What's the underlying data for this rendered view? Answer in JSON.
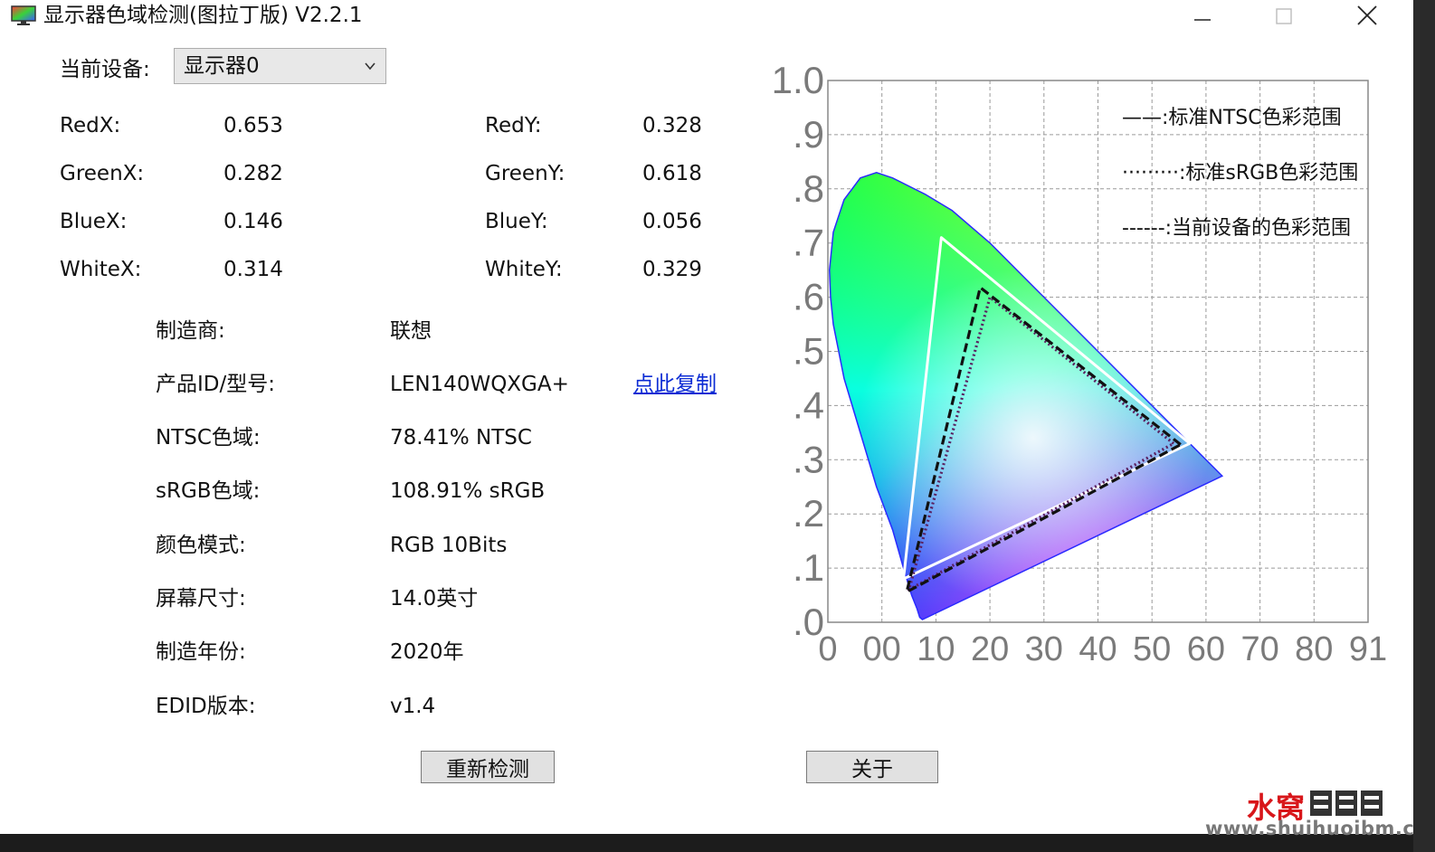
{
  "window": {
    "title": "显示器色域检测(图拉丁版) V2.2.1",
    "app_icon": "monitor-icon",
    "controls": [
      "minimize-icon",
      "maximize-icon",
      "close-icon"
    ]
  },
  "device": {
    "label": "当前设备:",
    "selected": "显示器0"
  },
  "coords": [
    {
      "xlabel": "RedX:",
      "xval": "0.653",
      "ylabel": "RedY:",
      "yval": "0.328"
    },
    {
      "xlabel": "GreenX:",
      "xval": "0.282",
      "ylabel": "GreenY:",
      "yval": "0.618"
    },
    {
      "xlabel": "BlueX:",
      "xval": "0.146",
      "ylabel": "BlueY:",
      "yval": "0.056"
    },
    {
      "xlabel": "WhiteX:",
      "xval": "0.314",
      "ylabel": "WhiteY:",
      "yval": "0.329"
    }
  ],
  "info": [
    {
      "label": "制造商:",
      "value": "联想"
    },
    {
      "label": "产品ID/型号:",
      "value": "LEN140WQXGA+"
    },
    {
      "label": "NTSC色域:",
      "value": "78.41% NTSC"
    },
    {
      "label": "sRGB色域:",
      "value": "108.91% sRGB"
    },
    {
      "label": "颜色模式:",
      "value": "RGB 10Bits"
    },
    {
      "label": "屏幕尺寸:",
      "value": "14.0英寸"
    },
    {
      "label": "制造年份:",
      "value": "2020年"
    },
    {
      "label": "EDID版本:",
      "value": "v1.4"
    }
  ],
  "copy_link": "点此复制",
  "buttons": {
    "redetect": "重新检测",
    "about": "关于"
  },
  "legend": [
    {
      "text": "——:标准NTSC色彩范围"
    },
    {
      "text": "·········:标准sRGB色彩范围"
    },
    {
      "text": "------:当前设备的色彩范围"
    }
  ],
  "watermark": {
    "brand": "水窝",
    "url": "www.shuihuoibm.com"
  },
  "chart_data": {
    "type": "scatter",
    "title": "",
    "xlabel": "",
    "ylabel": "",
    "y_ticks": [
      ".0",
      ".1",
      ".2",
      ".3",
      ".4",
      ".5",
      ".6",
      ".7",
      ".8",
      ".9",
      "1.0"
    ],
    "x_ticks": [
      "0",
      "00",
      "10",
      "20",
      "30",
      "40",
      "50",
      "60",
      "70",
      "80",
      "91"
    ],
    "xlim": [
      0,
      1
    ],
    "ylim": [
      0,
      1
    ],
    "grid": true,
    "series": [
      {
        "name": "标准NTSC色彩范围",
        "style": "solid",
        "color": "#ffffff",
        "points": [
          [
            0.67,
            0.33
          ],
          [
            0.21,
            0.71
          ],
          [
            0.14,
            0.08
          ]
        ]
      },
      {
        "name": "标准sRGB色彩范围",
        "style": "dotted",
        "color": "#5a2060",
        "points": [
          [
            0.64,
            0.33
          ],
          [
            0.3,
            0.6
          ],
          [
            0.15,
            0.06
          ]
        ]
      },
      {
        "name": "当前设备的色彩范围",
        "style": "dashed",
        "color": "#111111",
        "points": [
          [
            0.653,
            0.328
          ],
          [
            0.282,
            0.618
          ],
          [
            0.146,
            0.056
          ]
        ]
      }
    ],
    "locus": [
      [
        0.175,
        0.005
      ],
      [
        0.17,
        0.009
      ],
      [
        0.165,
        0.025
      ],
      [
        0.155,
        0.05
      ],
      [
        0.14,
        0.1
      ],
      [
        0.12,
        0.17
      ],
      [
        0.09,
        0.25
      ],
      [
        0.06,
        0.35
      ],
      [
        0.03,
        0.45
      ],
      [
        0.01,
        0.55
      ],
      [
        0.005,
        0.6
      ],
      [
        0.003,
        0.65
      ],
      [
        0.01,
        0.72
      ],
      [
        0.03,
        0.78
      ],
      [
        0.06,
        0.82
      ],
      [
        0.09,
        0.83
      ],
      [
        0.12,
        0.82
      ],
      [
        0.18,
        0.79
      ],
      [
        0.23,
        0.76
      ],
      [
        0.3,
        0.7
      ],
      [
        0.4,
        0.6
      ],
      [
        0.5,
        0.5
      ],
      [
        0.6,
        0.4
      ],
      [
        0.73,
        0.27
      ]
    ]
  }
}
